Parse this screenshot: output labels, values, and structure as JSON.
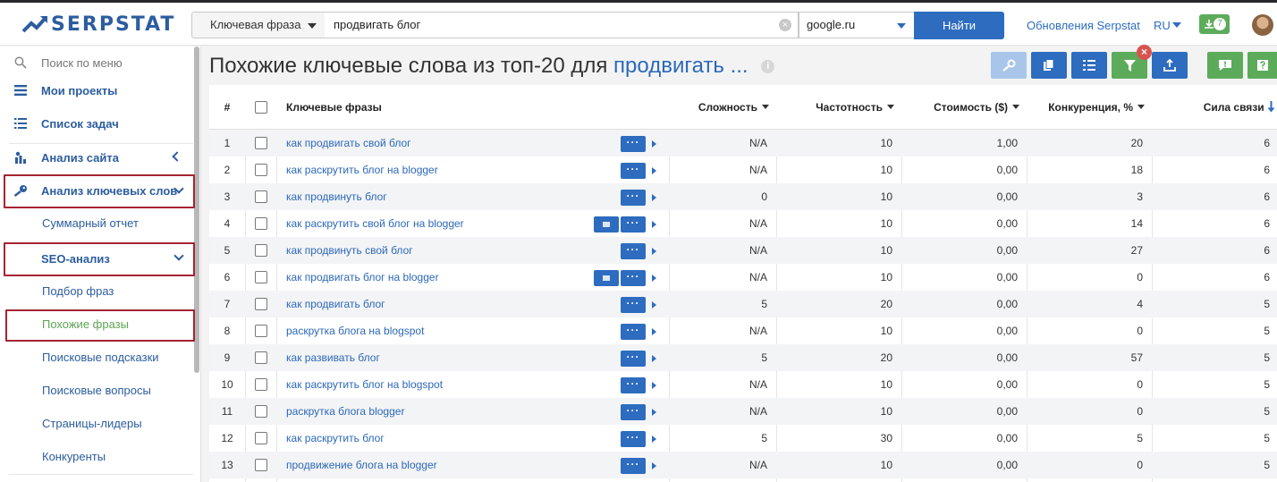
{
  "header": {
    "logo_text": "SERPSTAT",
    "search_type": "Ключевая фраза",
    "query": "продвигать блог",
    "engine": "google.ru",
    "find_label": "Найти",
    "updates_link": "Обновления Serpstat",
    "language": "RU",
    "downloads_count": "7"
  },
  "sidebar": {
    "search_placeholder": "Поиск по меню",
    "my_projects": "Мои проекты",
    "task_list": "Список задач",
    "site_analysis": "Анализ сайта",
    "keyword_analysis": "Анализ ключевых слов",
    "summary_report": "Суммарный отчет",
    "seo_analysis": "SEO-анализ",
    "phrase_selection": "Подбор фраз",
    "similar_phrases": "Похожие фразы",
    "search_suggestions": "Поисковые подсказки",
    "search_questions": "Поисковые вопросы",
    "top_pages": "Страницы-лидеры",
    "competitors": "Конкуренты"
  },
  "main": {
    "title_prefix": "Похожие ключевые слова из топ-20 для",
    "title_keyword": "продвигать ...",
    "info_icon": "i"
  },
  "toolbar": {
    "colors": {
      "light_blue": "#a9c6ea",
      "blue": "#2d6cbf",
      "green": "#5cab5a",
      "red": "#d9534f"
    },
    "icons": [
      "key-icon",
      "copy-icon",
      "columns-icon",
      "filter-icon",
      "export-icon",
      "feedback-icon",
      "help-icon"
    ]
  },
  "table": {
    "columns": {
      "num": "#",
      "keyword": "Ключевые фразы",
      "difficulty": "Сложность",
      "frequency": "Частотность",
      "cost": "Стоимость ($)",
      "competition": "Конкуренция, %",
      "connection": "Сила связи"
    },
    "rows": [
      {
        "num": "1",
        "keyword": "как продвигать свой блог",
        "difficulty": "N/A",
        "frequency": "10",
        "cost": "1,00",
        "competition": "20",
        "connection": "6",
        "has_image": false
      },
      {
        "num": "2",
        "keyword": "как раскрутить блог на blogger",
        "difficulty": "N/A",
        "frequency": "10",
        "cost": "0,00",
        "competition": "18",
        "connection": "6",
        "has_image": false
      },
      {
        "num": "3",
        "keyword": "как продвинуть блог",
        "difficulty": "0",
        "frequency": "10",
        "cost": "0,00",
        "competition": "3",
        "connection": "6",
        "has_image": false
      },
      {
        "num": "4",
        "keyword": "как раскрутить свой блог на blogger",
        "difficulty": "N/A",
        "frequency": "10",
        "cost": "0,00",
        "competition": "14",
        "connection": "6",
        "has_image": true
      },
      {
        "num": "5",
        "keyword": "как продвинуть свой блог",
        "difficulty": "N/A",
        "frequency": "10",
        "cost": "0,00",
        "competition": "27",
        "connection": "6",
        "has_image": false
      },
      {
        "num": "6",
        "keyword": "как продвигать блог на blogger",
        "difficulty": "N/A",
        "frequency": "10",
        "cost": "0,00",
        "competition": "0",
        "connection": "6",
        "has_image": true
      },
      {
        "num": "7",
        "keyword": "как продвигать блог",
        "difficulty": "5",
        "frequency": "20",
        "cost": "0,00",
        "competition": "4",
        "connection": "5",
        "has_image": false
      },
      {
        "num": "8",
        "keyword": "раскрутка блога на blogspot",
        "difficulty": "N/A",
        "frequency": "10",
        "cost": "0,00",
        "competition": "0",
        "connection": "5",
        "has_image": false
      },
      {
        "num": "9",
        "keyword": "как развивать блог",
        "difficulty": "5",
        "frequency": "20",
        "cost": "0,00",
        "competition": "57",
        "connection": "5",
        "has_image": false
      },
      {
        "num": "10",
        "keyword": "как раскрутить блог на blogspot",
        "difficulty": "N/A",
        "frequency": "10",
        "cost": "0,00",
        "competition": "0",
        "connection": "5",
        "has_image": false
      },
      {
        "num": "11",
        "keyword": "раскрутка блога blogger",
        "difficulty": "N/A",
        "frequency": "10",
        "cost": "0,00",
        "competition": "0",
        "connection": "5",
        "has_image": false
      },
      {
        "num": "12",
        "keyword": "как раскрутить блог",
        "difficulty": "5",
        "frequency": "30",
        "cost": "0,00",
        "competition": "5",
        "connection": "5",
        "has_image": false
      },
      {
        "num": "13",
        "keyword": "продвижение блога на blogger",
        "difficulty": "N/A",
        "frequency": "10",
        "cost": "0,00",
        "competition": "0",
        "connection": "5",
        "has_image": false
      }
    ],
    "dots_label": "···"
  }
}
